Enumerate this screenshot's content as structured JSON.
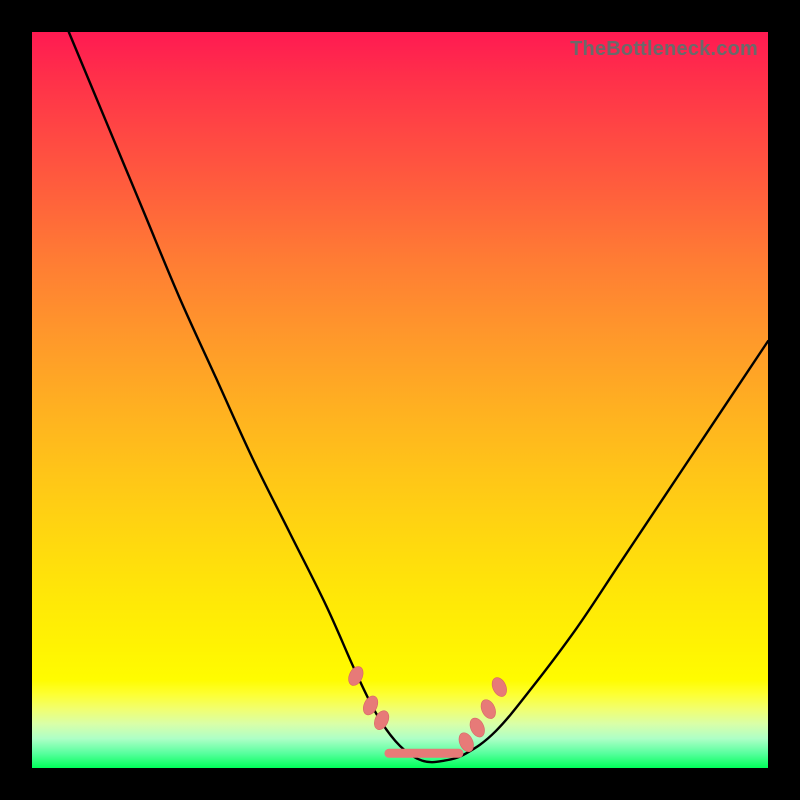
{
  "watermark": "TheBottleneck.com",
  "colors": {
    "frame": "#000000",
    "gradient_top": "#ff1a52",
    "gradient_mid": "#ffe807",
    "gradient_bottom": "#00ff5a",
    "curve": "#000000",
    "marker": "#e77a78"
  },
  "chart_data": {
    "type": "line",
    "title": "",
    "xlabel": "",
    "ylabel": "",
    "xlim": [
      0,
      100
    ],
    "ylim": [
      0,
      100
    ],
    "x": [
      5,
      10,
      15,
      20,
      25,
      30,
      35,
      40,
      44,
      47,
      50,
      53,
      56,
      59,
      63,
      68,
      74,
      80,
      86,
      92,
      100
    ],
    "y": [
      100,
      88,
      76,
      64,
      53,
      42,
      32,
      22,
      13,
      7,
      3,
      1,
      1,
      2,
      5,
      11,
      19,
      28,
      37,
      46,
      58
    ],
    "valley_markers_x": [
      44,
      46,
      47.5,
      59,
      60.5,
      62,
      63.5
    ],
    "valley_markers_y": [
      12.5,
      8.5,
      6.5,
      3.5,
      5.5,
      8,
      11
    ],
    "flat_segment": {
      "x0": 48.5,
      "x1": 58,
      "y": 2
    }
  }
}
